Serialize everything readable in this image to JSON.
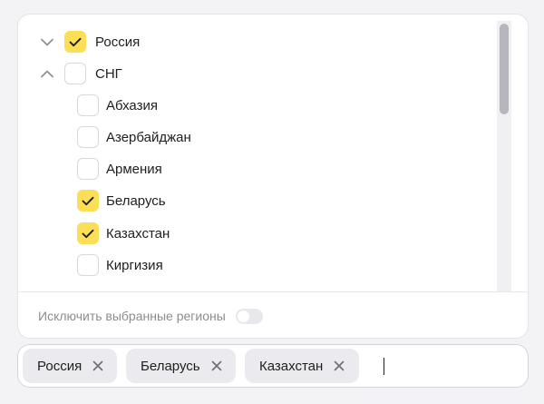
{
  "regions": [
    {
      "label": "Россия",
      "checked": true,
      "expander": "chevron-down"
    },
    {
      "label": "СНГ",
      "checked": false,
      "expander": "chevron-up"
    },
    {
      "label": "Абхазия",
      "checked": false
    },
    {
      "label": "Азербайджан",
      "checked": false
    },
    {
      "label": "Армения",
      "checked": false
    },
    {
      "label": "Беларусь",
      "checked": true
    },
    {
      "label": "Казахстан",
      "checked": true
    },
    {
      "label": "Киргизия",
      "checked": false
    }
  ],
  "footer": {
    "exclude_label": "Исключить выбранные регионы",
    "exclude_enabled": false
  },
  "selected_tags": [
    {
      "label": "Россия"
    },
    {
      "label": "Беларусь"
    },
    {
      "label": "Казахстан"
    }
  ],
  "colors": {
    "accent": "#fcdf57",
    "check_mark": "#21201f",
    "muted_text": "#8c8c92"
  },
  "icons": {
    "checkmark": "check-icon",
    "expand": "chevron-down-icon",
    "collapse": "chevron-up-icon",
    "remove": "close-icon"
  }
}
